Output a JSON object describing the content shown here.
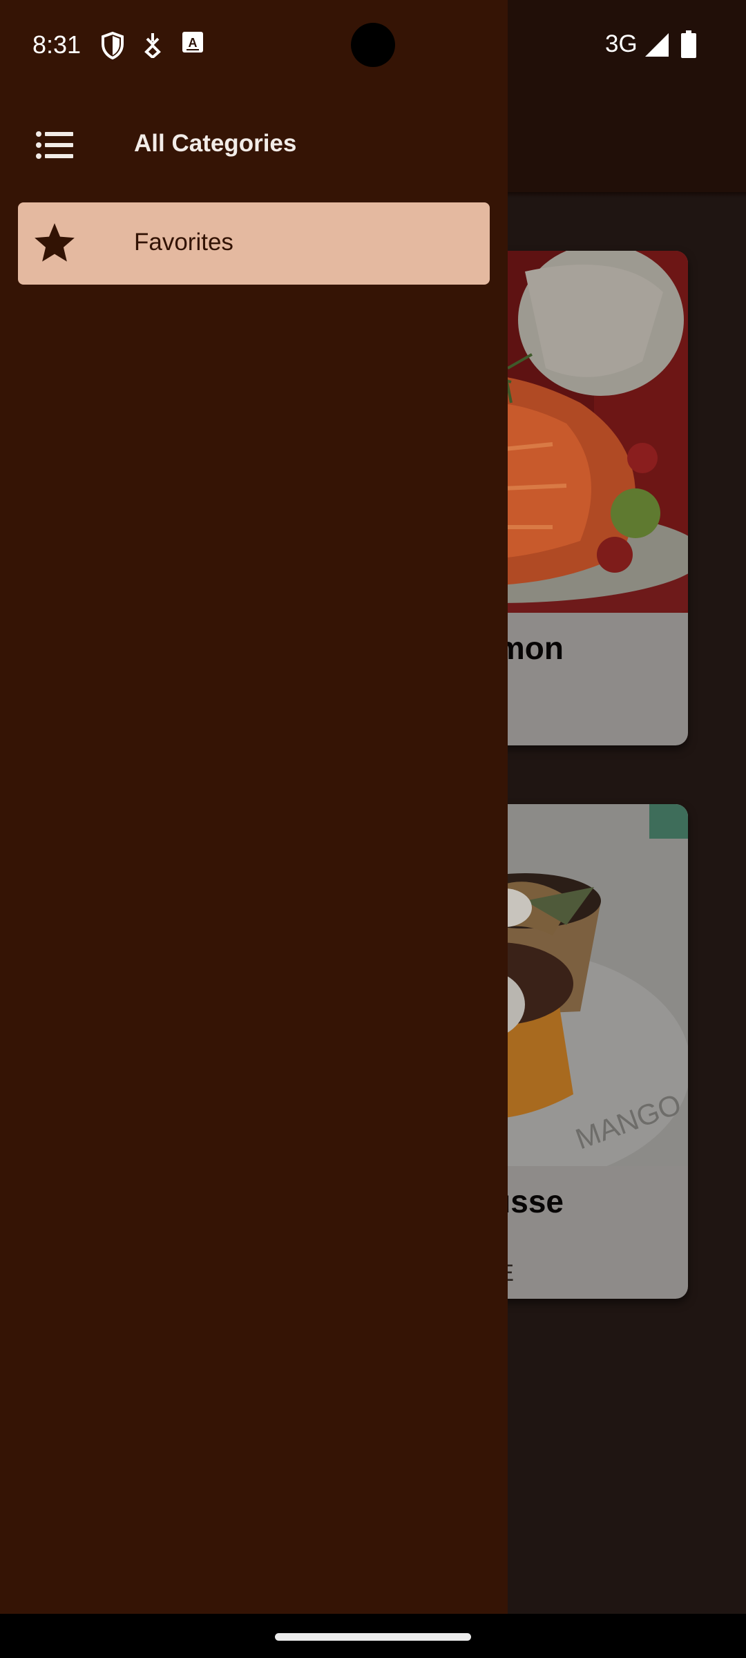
{
  "status_bar": {
    "time": "8:31",
    "icons": [
      "shield-icon",
      "download-icon",
      "keyboard-a-icon"
    ],
    "network": "3G",
    "signal_icon": "cell-signal-icon",
    "battery_icon": "battery-icon"
  },
  "drawer": {
    "header": {
      "icon": "list-menu-icon",
      "title": "All Categories"
    },
    "items": [
      {
        "icon": "star-icon",
        "label": "Favorites",
        "selected": true
      }
    ]
  },
  "background_cards": [
    {
      "title_visible": "lmon",
      "image": "salmon-dish-photo"
    },
    {
      "title_visible": "usse",
      "subtitle_visible": "E",
      "image": "mango-mousse-photo"
    }
  ],
  "colors": {
    "drawer_bg": "#351405",
    "selected_item_bg": "#e4b9a0",
    "scrim": "#1f1512",
    "nav_bar": "#000000"
  }
}
